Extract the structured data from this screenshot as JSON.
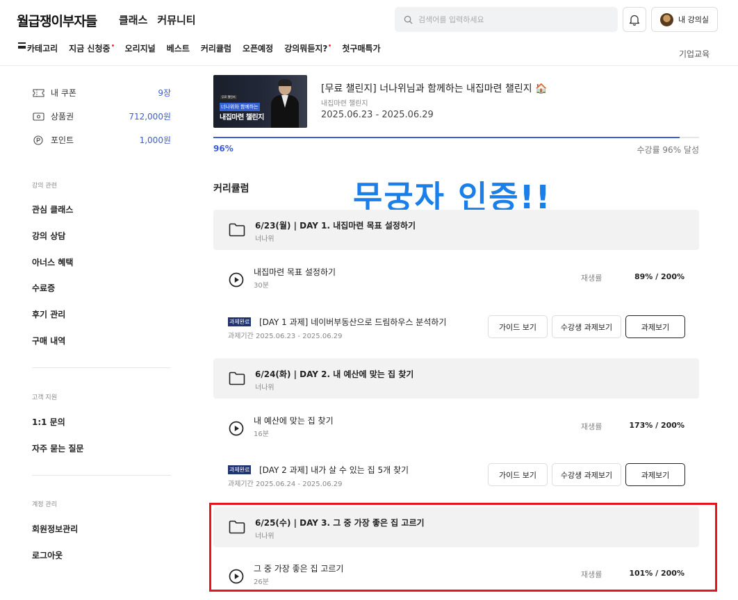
{
  "header": {
    "logo": "월급쟁이부자들",
    "nav": [
      "클래스",
      "커뮤니티"
    ],
    "search_placeholder": "검색어를 입력하세요",
    "my_lecture_label": "내 강의실",
    "categories": [
      {
        "label": "카테고리",
        "dot": false
      },
      {
        "label": "지금 신청중",
        "dot": true
      },
      {
        "label": "오리지널",
        "dot": false
      },
      {
        "label": "베스트",
        "dot": false
      },
      {
        "label": "커리큘럼",
        "dot": false
      },
      {
        "label": "오픈예정",
        "dot": false
      },
      {
        "label": "강의뭐듣지?",
        "dot": true
      },
      {
        "label": "첫구매특가",
        "dot": false
      }
    ],
    "corp_label": "기업교육"
  },
  "sidebar": {
    "wallet": [
      {
        "icon": "coupon-icon",
        "label": "내 쿠폰",
        "value": "9장"
      },
      {
        "icon": "gift-card-icon",
        "label": "상품권",
        "value": "712,000원"
      },
      {
        "icon": "point-icon",
        "label": "포인트",
        "value": "1,000원"
      }
    ],
    "groups": [
      {
        "caption": "강의 관련",
        "links": [
          "관심 클래스",
          "강의 상담",
          "아너스 혜택",
          "수료증",
          "후기 관리",
          "구매 내역"
        ]
      },
      {
        "caption": "고객 지원",
        "links": [
          "1:1 문의",
          "자주 묻는 질문"
        ]
      },
      {
        "caption": "계정 관리",
        "links": [
          "회원정보관리",
          "로그아웃"
        ]
      }
    ]
  },
  "course": {
    "thumb_tag": "무료 챌린지",
    "thumb_sub": "너나위와 함께하는",
    "thumb_title": "내집마련 챌린지",
    "title": "[무료 챌린지] 너나위님과 함께하는 내집마련 챌린지 🏠",
    "subtitle": "내집마련 챌린지",
    "dates": "2025.06.23 - 2025.06.29",
    "progress": 0.96,
    "progress_label": "96%",
    "rate_label": "수강률 96% 달성"
  },
  "curriculum": {
    "title": "커리큘럼",
    "overlay": "무궁자 인증!!",
    "sections": [
      {
        "title": "6/23(월) | DAY 1. 내집마련 목표 설정하기",
        "instructor": "너나위",
        "lecture": {
          "title": "내집마련 목표 설정하기",
          "duration": "30분",
          "play_label": "재생률",
          "play_value": "89% / 200%"
        },
        "assignment": {
          "badge": "과제완료",
          "title": "[DAY 1 과제] 네이버부동산으로 드림하우스 분석하기",
          "period": "과제기간 2025.06.23 - 2025.06.29",
          "guide": "가이드 보기",
          "peer": "수강생 과제보기",
          "view": "과제보기"
        }
      },
      {
        "title": "6/24(화) | DAY 2. 내 예산에 맞는 집 찾기",
        "instructor": "너나위",
        "lecture": {
          "title": "내 예산에 맞는 집 찾기",
          "duration": "16분",
          "play_label": "재생률",
          "play_value": "173% / 200%"
        },
        "assignment": {
          "badge": "과제완료",
          "title": "[DAY 2 과제] 내가 살 수 있는 집 5개 찾기",
          "period": "과제기간 2025.06.24 - 2025.06.29",
          "guide": "가이드 보기",
          "peer": "수강생 과제보기",
          "view": "과제보기"
        }
      },
      {
        "title": "6/25(수) | DAY 3. 그 중 가장 좋은 집 고르기",
        "instructor": "너나위",
        "lecture": {
          "title": "그 중 가장 좋은 집 고르기",
          "duration": "26분",
          "play_label": "재생률",
          "play_value": "101% / 200%"
        }
      }
    ]
  },
  "colors": {
    "accent": "#3b5bdb",
    "badge": "#1f3470",
    "highlight": "#e8141c",
    "overlay": "#1a7fe8"
  }
}
